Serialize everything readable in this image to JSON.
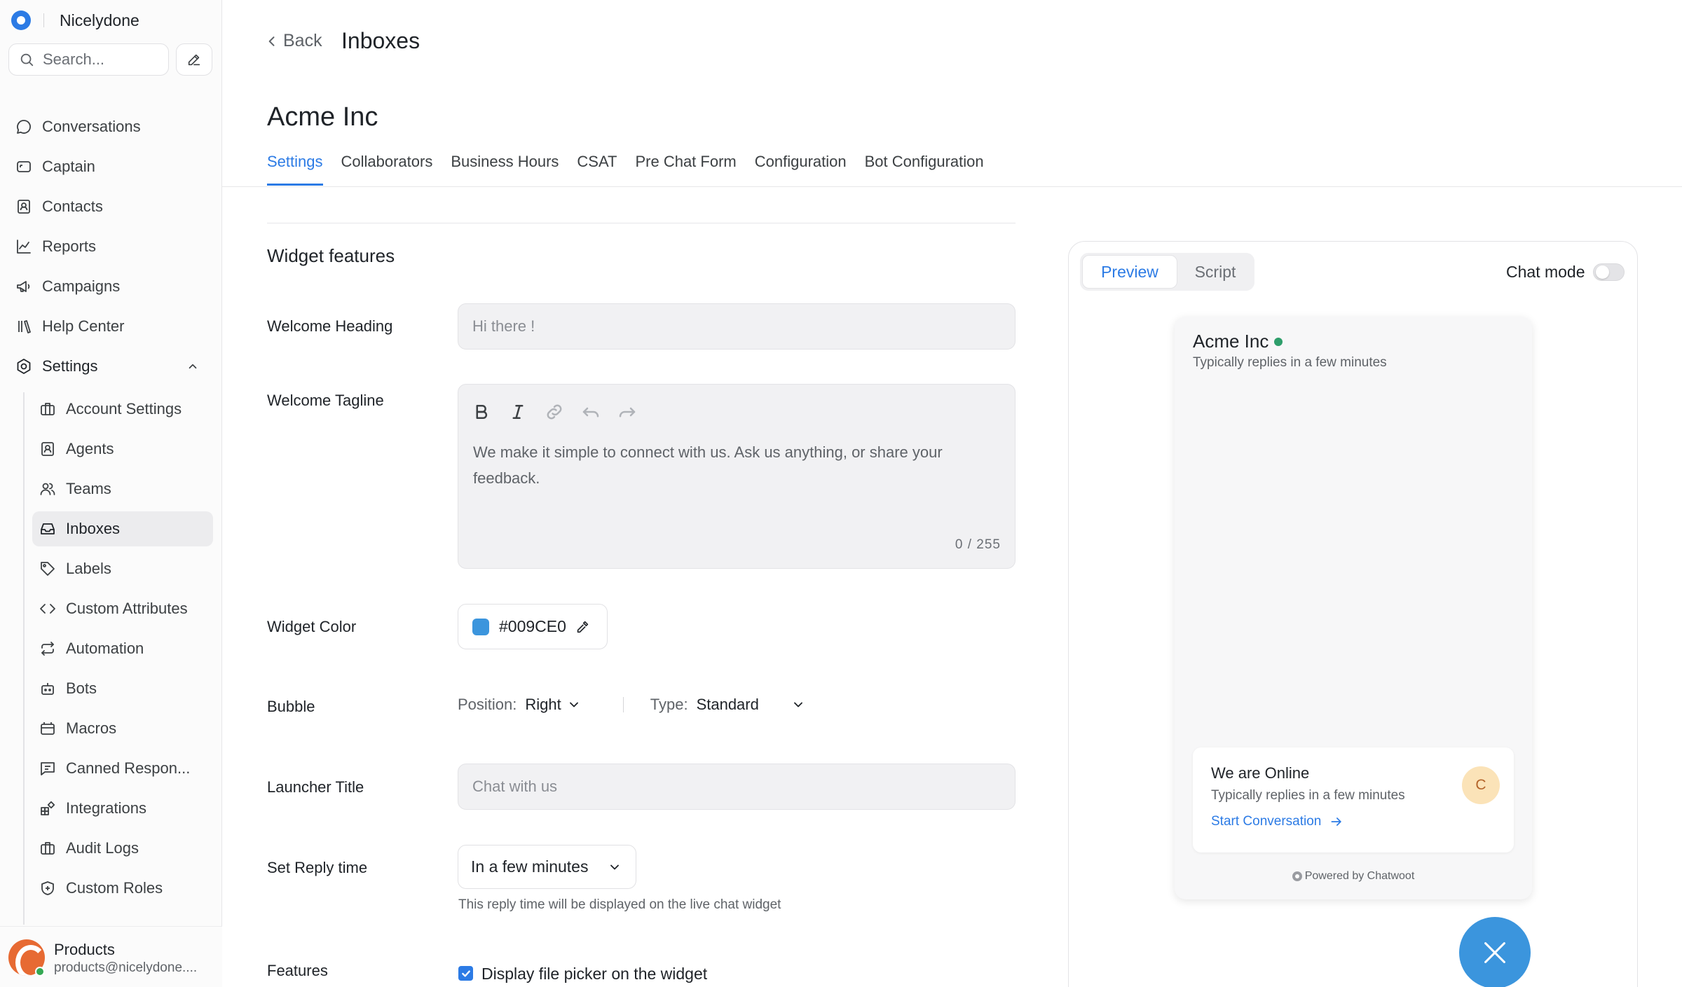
{
  "sidebar": {
    "brand": "Nicelydone",
    "search_placeholder": "Search...",
    "nav": [
      {
        "label": "Conversations",
        "icon": "chat-bubble-icon"
      },
      {
        "label": "Captain",
        "icon": "captain-icon"
      },
      {
        "label": "Contacts",
        "icon": "contacts-icon"
      },
      {
        "label": "Reports",
        "icon": "chart-line-icon"
      },
      {
        "label": "Campaigns",
        "icon": "megaphone-icon"
      },
      {
        "label": "Help Center",
        "icon": "library-icon"
      },
      {
        "label": "Settings",
        "icon": "settings-icon"
      }
    ],
    "settings_items": [
      {
        "label": "Account Settings",
        "icon": "briefcase-icon"
      },
      {
        "label": "Agents",
        "icon": "agent-icon"
      },
      {
        "label": "Teams",
        "icon": "users-icon"
      },
      {
        "label": "Inboxes",
        "icon": "inbox-icon"
      },
      {
        "label": "Labels",
        "icon": "tag-icon"
      },
      {
        "label": "Custom Attributes",
        "icon": "code-icon"
      },
      {
        "label": "Automation",
        "icon": "repeat-icon"
      },
      {
        "label": "Bots",
        "icon": "bot-icon"
      },
      {
        "label": "Macros",
        "icon": "macro-icon"
      },
      {
        "label": "Canned Respon...",
        "icon": "canned-response-icon"
      },
      {
        "label": "Integrations",
        "icon": "integrations-icon"
      },
      {
        "label": "Audit Logs",
        "icon": "briefcase-icon"
      },
      {
        "label": "Custom Roles",
        "icon": "shield-icon"
      }
    ],
    "user": {
      "name": "Products",
      "email": "products@nicelydone...."
    }
  },
  "header": {
    "back_label": "Back",
    "title": "Inboxes"
  },
  "inbox_name": "Acme Inc",
  "tabs": [
    "Settings",
    "Collaborators",
    "Business Hours",
    "CSAT",
    "Pre Chat Form",
    "Configuration",
    "Bot Configuration"
  ],
  "form": {
    "section_title": "Widget features",
    "welcome_heading": {
      "label": "Welcome Heading",
      "placeholder": "Hi there !"
    },
    "welcome_tagline": {
      "label": "Welcome Tagline",
      "placeholder": "We make it simple to connect with us. Ask us anything, or share your feedback.",
      "count": "0 / 255"
    },
    "widget_color": {
      "label": "Widget Color",
      "value": "#009CE0",
      "swatch": "#3b95dd"
    },
    "bubble": {
      "label": "Bubble",
      "position_label": "Position:",
      "position_value": "Right",
      "type_label": "Type:",
      "type_value": "Standard"
    },
    "launcher_title": {
      "label": "Launcher Title",
      "placeholder": "Chat with us"
    },
    "reply_time": {
      "label": "Set Reply time",
      "value": "In a few minutes",
      "help": "This reply time will be displayed on the live chat widget"
    },
    "features": {
      "label": "Features",
      "items": [
        {
          "label": "Display file picker on the widget",
          "checked": true
        }
      ]
    }
  },
  "preview": {
    "tabs": [
      "Preview",
      "Script"
    ],
    "chat_mode_label": "Chat mode",
    "chat_mode_on": false,
    "widget": {
      "title": "Acme Inc",
      "subtitle": "Typically replies in a few minutes",
      "card_title": "We are Online",
      "card_subtitle": "Typically replies in a few minutes",
      "card_link": "Start Conversation",
      "avatar_initial": "C",
      "powered_by": "Powered by Chatwoot"
    }
  },
  "colors": {
    "accent": "#2c7be5",
    "widget": "#3b95dd",
    "online": "#2e9e6b"
  }
}
